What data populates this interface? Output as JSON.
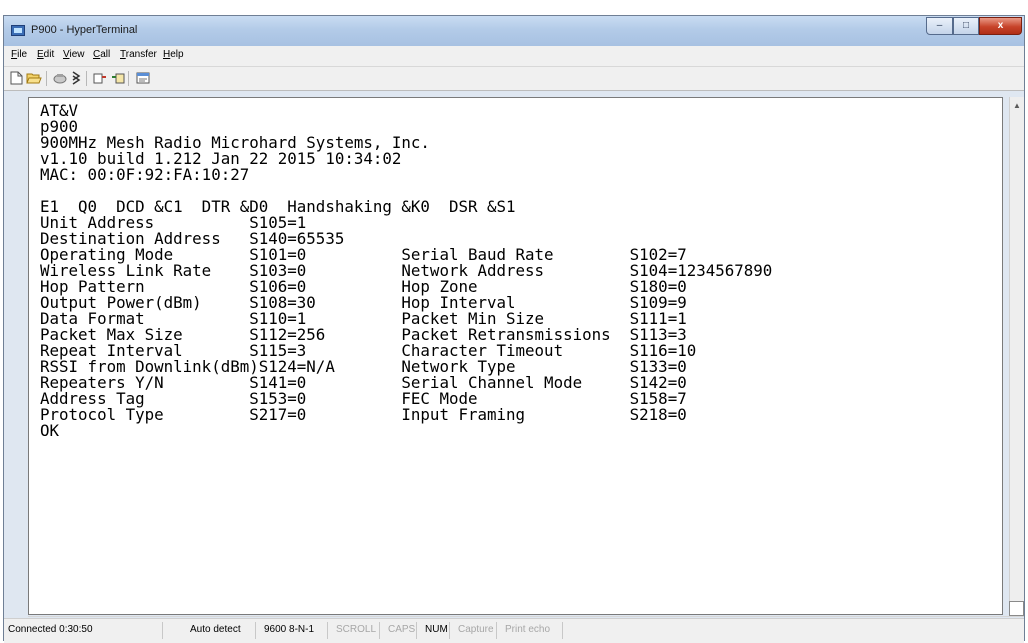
{
  "window": {
    "title": "P900 - HyperTerminal",
    "controls": {
      "minimize": "–",
      "maximize": "□",
      "close": "x"
    }
  },
  "menu": [
    {
      "label": "File",
      "underline": "F",
      "rest": "ile"
    },
    {
      "label": "Edit",
      "underline": "E",
      "rest": "dit"
    },
    {
      "label": "View",
      "underline": "V",
      "rest": "iew"
    },
    {
      "label": "Call",
      "underline": "C",
      "rest": "all"
    },
    {
      "label": "Transfer",
      "underline": "T",
      "rest": "ransfer"
    },
    {
      "label": "Help",
      "underline": "H",
      "rest": "elp"
    }
  ],
  "toolbar": {
    "icons": [
      "new-connection-icon",
      "open-icon",
      "call-icon",
      "disconnect-icon",
      "send-icon",
      "receive-icon",
      "properties-icon"
    ]
  },
  "terminal": {
    "lines": [
      "AT&V",
      "p900",
      "900MHz Mesh Radio Microhard Systems, Inc.",
      "v1.10 build 1.212 Jan 22 2015 10:34:02",
      "MAC: 00:0F:92:FA:10:27",
      "",
      "E1  Q0  DCD &C1  DTR &D0  Handshaking &K0  DSR &S1",
      "Unit Address          S105=1",
      "Destination Address   S140=65535",
      "Operating Mode        S101=0          Serial Baud Rate        S102=7",
      "Wireless Link Rate    S103=0          Network Address         S104=1234567890",
      "Hop Pattern           S106=0          Hop Zone                S180=0",
      "Output Power(dBm)     S108=30         Hop Interval            S109=9",
      "Data Format           S110=1          Packet Min Size         S111=1",
      "Packet Max Size       S112=256        Packet Retransmissions  S113=3",
      "Repeat Interval       S115=3          Character Timeout       S116=10",
      "RSSI from Downlink(dBm)S124=N/A       Network Type            S133=0",
      "Repeaters Y/N         S141=0          Serial Channel Mode     S142=0",
      "Address Tag           S153=0          FEC Mode                S158=7",
      "Protocol Type         S217=0          Input Framing           S218=0",
      "OK"
    ]
  },
  "status_bar": {
    "connected": "Connected 0:30:50",
    "detect": "Auto detect",
    "settings": "9600 8-N-1",
    "scroll": "SCROLL",
    "caps": "CAPS",
    "num": "NUM",
    "capture": "Capture",
    "print_echo": "Print echo"
  }
}
